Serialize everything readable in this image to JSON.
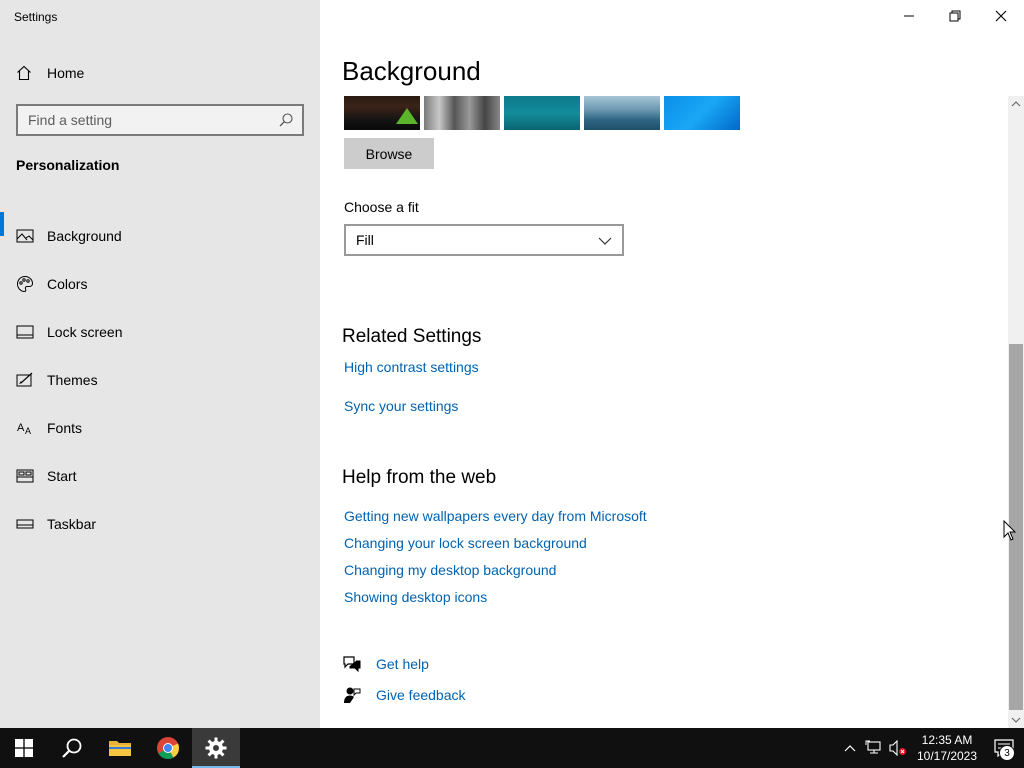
{
  "window": {
    "app_title": "Settings"
  },
  "sidebar": {
    "home_label": "Home",
    "search_placeholder": "Find a setting",
    "section_label": "Personalization",
    "items": [
      {
        "label": "Background",
        "icon": "picture-icon",
        "active": true
      },
      {
        "label": "Colors",
        "icon": "palette-icon",
        "active": false
      },
      {
        "label": "Lock screen",
        "icon": "lock-screen-icon",
        "active": false
      },
      {
        "label": "Themes",
        "icon": "themes-icon",
        "active": false
      },
      {
        "label": "Fonts",
        "icon": "fonts-icon",
        "active": false
      },
      {
        "label": "Start",
        "icon": "start-icon",
        "active": false
      },
      {
        "label": "Taskbar",
        "icon": "taskbar-icon",
        "active": false
      }
    ]
  },
  "main": {
    "title": "Background",
    "browse_label": "Browse",
    "fit_label": "Choose a fit",
    "fit_value": "Fill",
    "related_heading": "Related Settings",
    "related_links": [
      "High contrast settings",
      "Sync your settings"
    ],
    "help_heading": "Help from the web",
    "help_links": [
      "Getting new wallpapers every day from Microsoft",
      "Changing your lock screen background",
      "Changing my desktop background",
      "Showing desktop icons"
    ],
    "get_help_label": "Get help",
    "feedback_label": "Give feedback"
  },
  "taskbar": {
    "time": "12:35 AM",
    "date": "10/17/2023",
    "notification_count": "3"
  },
  "colors": {
    "accent": "#0078d7",
    "link": "#0063b1",
    "sidebar_bg": "#e6e6e6",
    "taskbar_bg": "#101010"
  }
}
